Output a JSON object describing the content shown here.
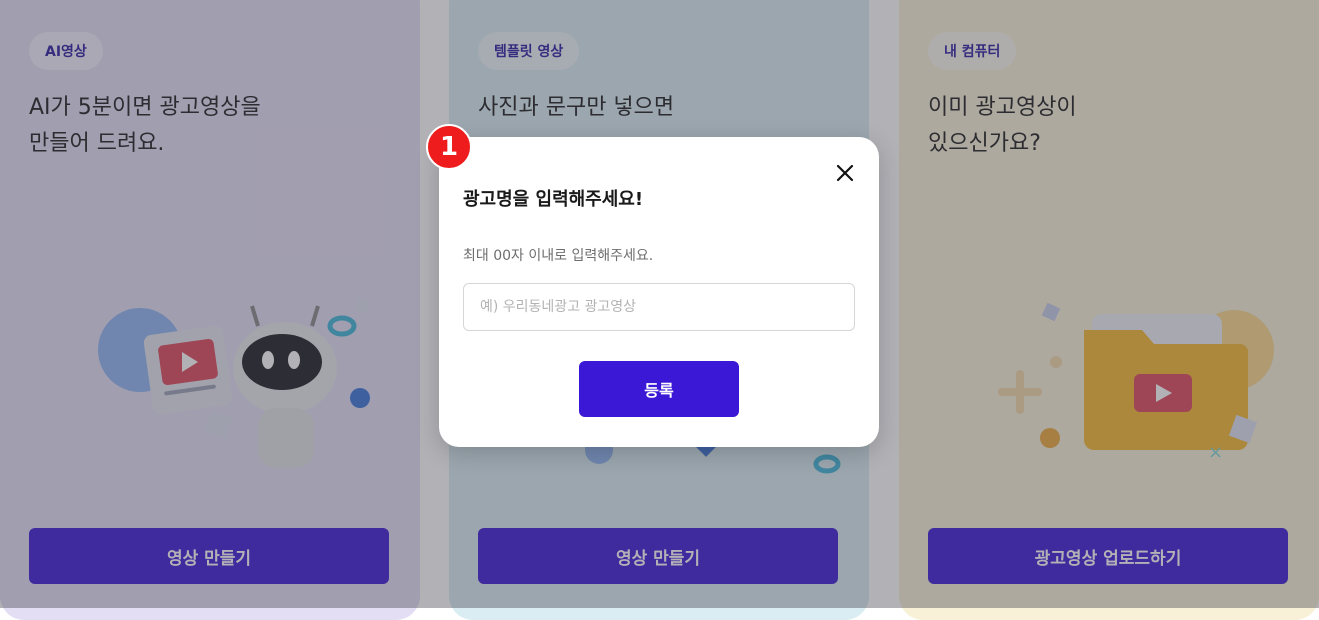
{
  "cards": [
    {
      "badge": "AI영상",
      "headline": "AI가 5분이면 광고영상을\n만들어 드려요.",
      "button": "영상 만들기",
      "bg": "#e4def5"
    },
    {
      "badge": "템플릿 영상",
      "headline": "사진과 문구만 넣으면",
      "button": "영상 만들기",
      "bg": "#d9edf2"
    },
    {
      "badge": "내 컴퓨터",
      "headline": "이미 광고영상이\n있으신가요?",
      "button": "광고영상 업로드하기",
      "bg": "#f8f1d8"
    }
  ],
  "modal": {
    "step_number": "1",
    "title": "광고명을 입력해주세요!",
    "hint": "최대 00자 이내로 입력해주세요.",
    "input_value": "",
    "input_placeholder": "예) 우리동네광고 광고영상",
    "submit_label": "등록"
  },
  "colors": {
    "primary": "#3b18d6",
    "step_badge": "#ee1c1c"
  }
}
